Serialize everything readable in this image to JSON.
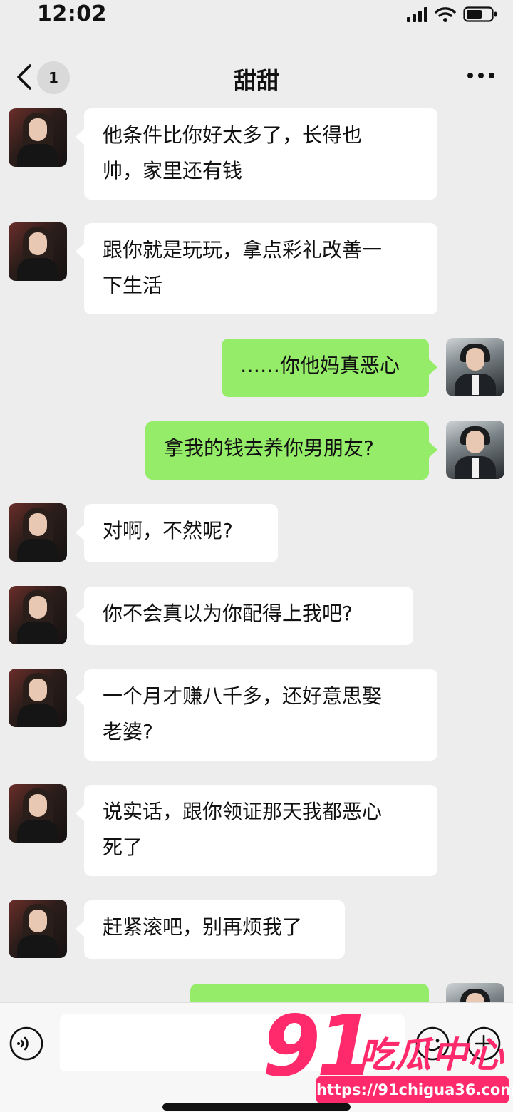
{
  "status_bar": {
    "time": "12:02"
  },
  "nav": {
    "unread_count": "1",
    "title": "甜甜"
  },
  "messages": [
    {
      "sender": "her",
      "lines": [
        "他条件比你好太多了，长得也",
        "帅，家里还有钱"
      ]
    },
    {
      "sender": "her",
      "lines": [
        "跟你就是玩玩，拿点彩礼改善一",
        "下生活"
      ]
    },
    {
      "sender": "me",
      "lines": [
        "……你他妈真恶心"
      ]
    },
    {
      "sender": "me",
      "lines": [
        "拿我的钱去养你男朋友?"
      ]
    },
    {
      "sender": "her",
      "lines": [
        "对啊，不然呢?"
      ]
    },
    {
      "sender": "her",
      "lines": [
        "你不会真以为你配得上我吧?"
      ]
    },
    {
      "sender": "her",
      "lines": [
        "一个月才赚八千多，还好意思娶",
        "老婆?"
      ]
    },
    {
      "sender": "her",
      "lines": [
        "说实话，跟你领证那天我都恶心",
        "死了"
      ]
    },
    {
      "sender": "her",
      "lines": [
        "赶紧滚吧，别再烦我了"
      ]
    }
  ],
  "input": {
    "value": ""
  },
  "watermark": {
    "number": "91",
    "title": "吃瓜中心",
    "url": "https://91chigua36.com"
  },
  "colors": {
    "my_bubble": "#95ec69",
    "their_bubble": "#ffffff",
    "background": "#ededed",
    "watermark": "#ff2a6b"
  }
}
